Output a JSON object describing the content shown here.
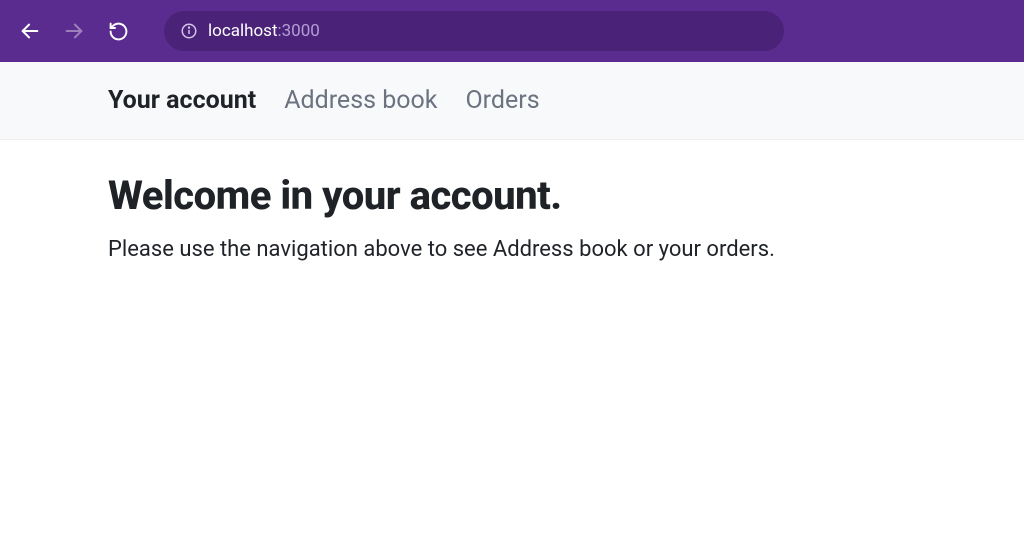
{
  "browser": {
    "url_host": "localhost",
    "url_port": ":3000"
  },
  "nav": {
    "tabs": [
      {
        "label": "Your account",
        "active": true
      },
      {
        "label": "Address book",
        "active": false
      },
      {
        "label": "Orders",
        "active": false
      }
    ]
  },
  "page": {
    "title": "Welcome in your account.",
    "subtitle": "Please use the navigation above to see Address book or your orders."
  }
}
